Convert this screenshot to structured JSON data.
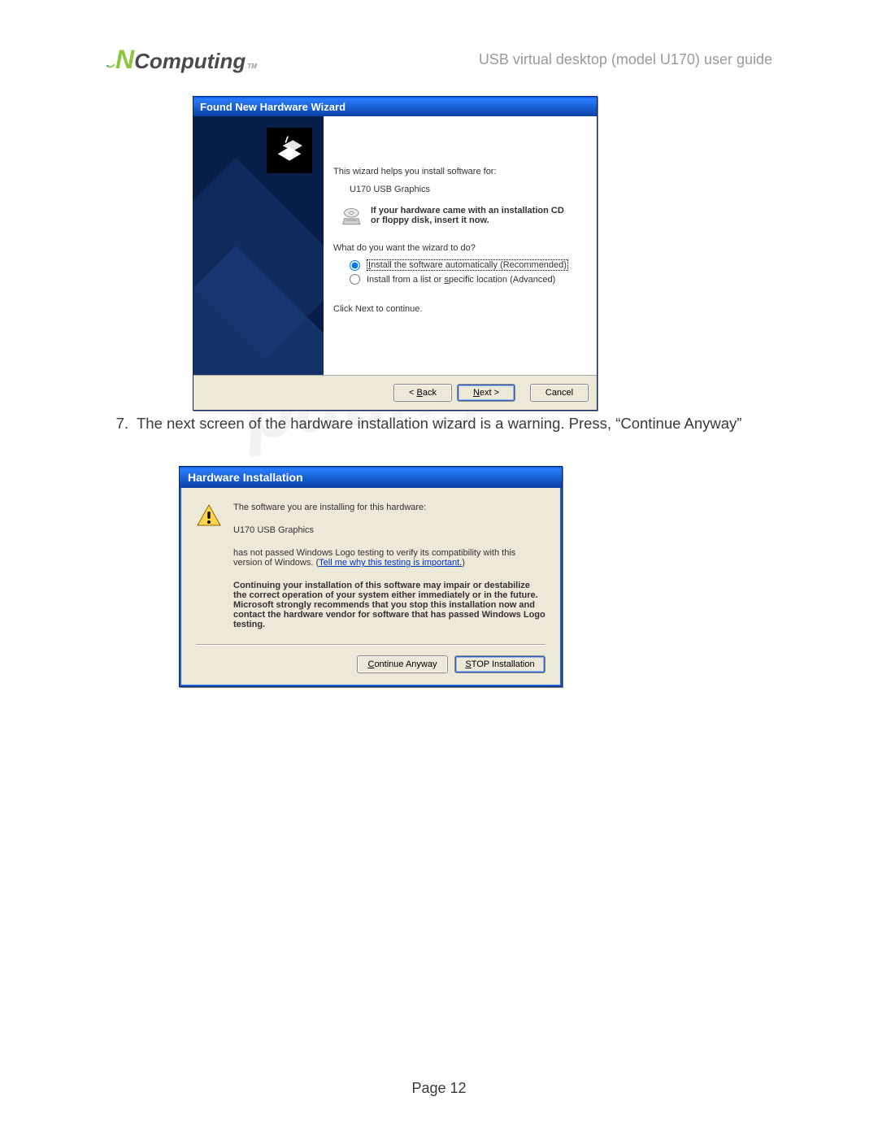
{
  "header": {
    "logo_n": "N",
    "logo_rest": "Computing",
    "logo_tm": "TM",
    "right_text": "USB virtual desktop (model U170) user guide"
  },
  "wizard1": {
    "title": "Found New Hardware Wizard",
    "intro": "This wizard helps you install software for:",
    "device": "U170 USB Graphics",
    "cd_hint_line1": "If your hardware came with an installation CD",
    "cd_hint_line2": "or floppy disk, insert it now.",
    "prompt": "What do you want the wizard to do?",
    "radio1_prefix": "I",
    "radio1_rest": "nstall the software automatically (Recommended)",
    "radio2_prefix": "Install from a list or ",
    "radio2_key": "s",
    "radio2_suffix": "pecific location (Advanced)",
    "click_next": "Click Next to continue.",
    "back_key": "B",
    "back_rest": "ack",
    "next_key": "N",
    "next_rest": "ext >",
    "back_prefix": "< ",
    "cancel": "Cancel"
  },
  "step7": {
    "num": "7.",
    "text": "The next screen of the hardware installation wizard is a warning. Press, “Continue Anyway”"
  },
  "dialog2": {
    "title": "Hardware Installation",
    "line1": "The software you are installing for this hardware:",
    "device": "U170 USB Graphics",
    "line2a": "has not passed Windows Logo testing to verify its compatibility with this version of Windows. (",
    "link_text": "Tell me why this testing is important.",
    "line2b": ")",
    "bold_text": "Continuing your installation of this software may impair or destabilize the correct operation of your system either immediately or in the future. Microsoft strongly recommends that you stop this installation now and contact the hardware vendor for software that has passed Windows Logo testing.",
    "continue_key": "C",
    "continue_rest": "ontinue Anyway",
    "stop_key": "S",
    "stop_rest": "TOP Installation"
  },
  "footer": {
    "page": "Page 12"
  }
}
